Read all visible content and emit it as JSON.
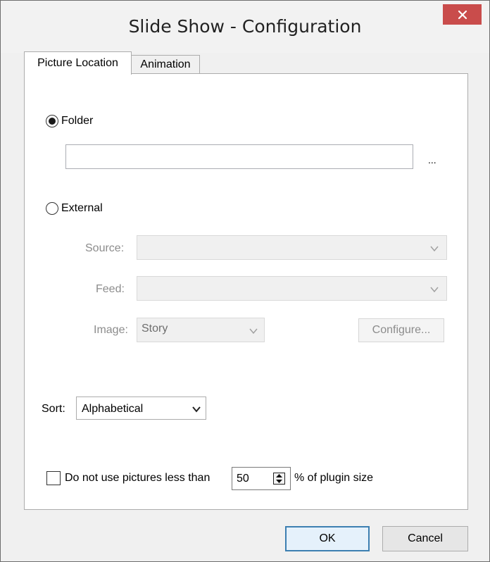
{
  "window": {
    "title": "Slide Show - Configuration"
  },
  "tabs": [
    {
      "label": "Picture Location",
      "active": true
    },
    {
      "label": "Animation",
      "active": false
    }
  ],
  "folder": {
    "label": "Folder",
    "selected": true,
    "path_value": "",
    "browse_label": "..."
  },
  "external": {
    "label": "External",
    "selected": false,
    "source_label": "Source:",
    "source_value": "",
    "feed_label": "Feed:",
    "feed_value": "",
    "image_label": "Image:",
    "image_value": "Story",
    "configure_label": "Configure..."
  },
  "sort": {
    "label": "Sort:",
    "value": "Alphabetical"
  },
  "min_size": {
    "checked": false,
    "label": "Do not use pictures less than",
    "value": "50",
    "suffix": "% of plugin size"
  },
  "buttons": {
    "ok": "OK",
    "cancel": "Cancel"
  },
  "colors": {
    "close_button": "#c94c4b",
    "default_button_border": "#3c7fb1"
  },
  "icons": [
    "close-icon",
    "chevron-down-icon",
    "spin-up-icon",
    "spin-down-icon"
  ]
}
